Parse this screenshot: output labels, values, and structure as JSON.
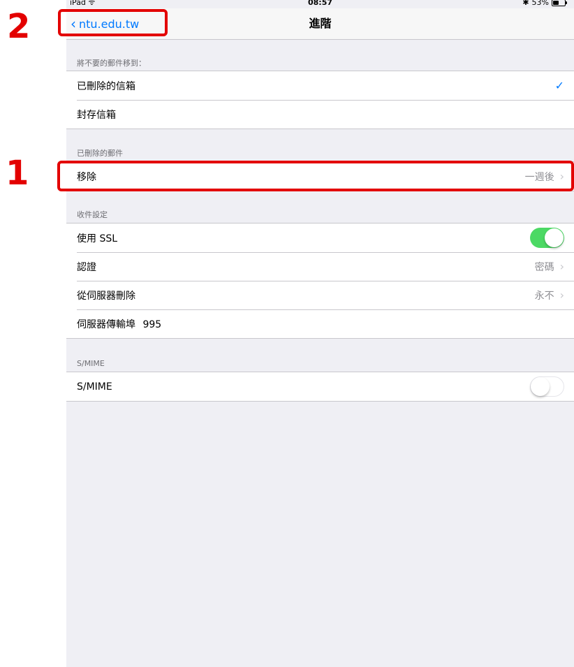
{
  "status": {
    "carrier": "iPad",
    "time": "08:57",
    "battery": "53%",
    "battery_level": 0.53
  },
  "nav": {
    "back_label": "ntu.edu.tw",
    "title": "進階"
  },
  "sections": {
    "move_discarded": {
      "header": "將不要的郵件移到：",
      "deleted_mailbox": "已刪除的信箱",
      "archive_mailbox": "封存信箱"
    },
    "deleted_messages": {
      "header": "已刪除的郵件",
      "remove_label": "移除",
      "remove_value": "一週後"
    },
    "incoming": {
      "header": "收件設定",
      "ssl_label": "使用 SSL",
      "ssl_on": true,
      "auth_label": "認證",
      "auth_value": "密碼",
      "delete_server_label": "從伺服器刪除",
      "delete_server_value": "永不",
      "port_label": "伺服器傳輸埠",
      "port_value": "995"
    },
    "smime": {
      "header": "S/MIME",
      "label": "S/MIME",
      "on": false
    }
  },
  "annotations": {
    "marker_1": "1",
    "marker_2": "2",
    "color": "#e30000"
  },
  "colors": {
    "accent": "#007aff",
    "toggle_on": "#4cd964",
    "background": "#efeff4"
  }
}
